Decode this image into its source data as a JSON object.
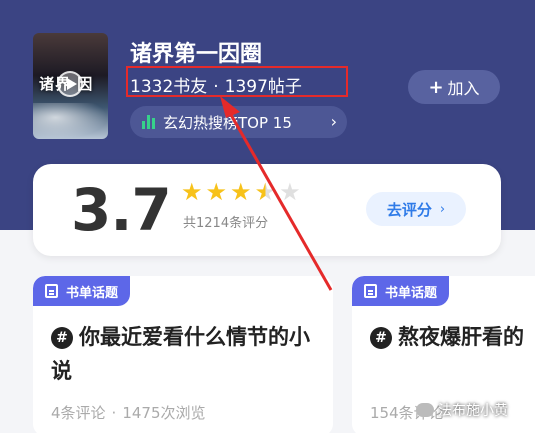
{
  "circle": {
    "name": "诸界第一因圈",
    "members": "1332书友",
    "separator": "·",
    "posts": "1397帖子",
    "rank_label": "玄幻热搜榜TOP 15",
    "join_label": "加入",
    "cover_title": "诸界·因"
  },
  "rating": {
    "score": "3.7",
    "count_label": "共1214条评分",
    "rate_label": "去评分",
    "stars": [
      {
        "state": "full"
      },
      {
        "state": "full"
      },
      {
        "state": "full"
      },
      {
        "state": "half"
      },
      {
        "state": "empty"
      }
    ]
  },
  "topics": [
    {
      "tag": "书单话题",
      "title": "你最近爱看什么情节的小说",
      "comments": "4条评论",
      "views": "1475次浏览"
    },
    {
      "tag": "书单话题",
      "title": "熬夜爆肝看的",
      "comments": "154条评论",
      "views": ""
    }
  ],
  "watermark": "法布施小黄",
  "colors": {
    "header_bg": "#3b4483",
    "highlight_box": "#e52a2a",
    "star": "#f7c21a",
    "tag_bg": "#5d67e8",
    "rate_btn_text": "#2f7be8",
    "rank_icon": "#36d28a"
  },
  "icons": {
    "join": "plus-icon",
    "rank": "bar-chart-icon",
    "rank_more": "chevron-right-icon",
    "rate_more": "chevron-right-icon",
    "tag": "document-icon",
    "topic": "hashtag-icon"
  }
}
